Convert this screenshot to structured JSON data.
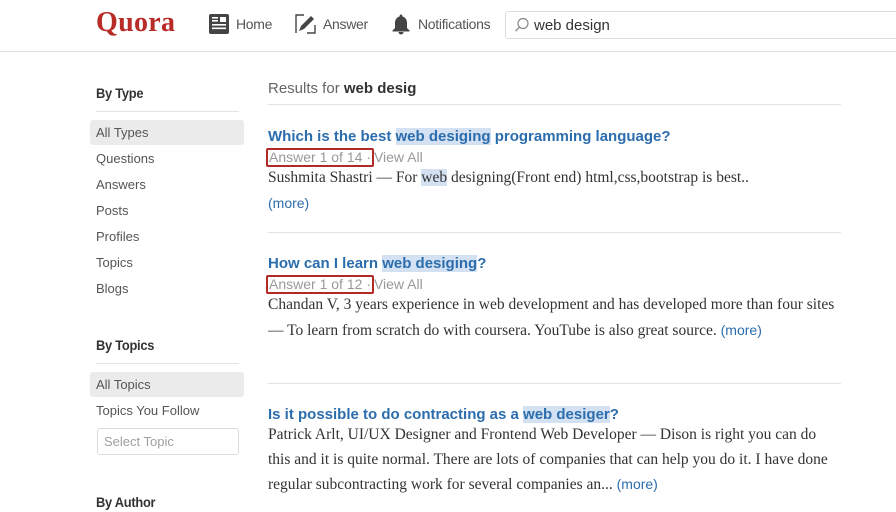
{
  "header": {
    "logo": "Quora",
    "nav": [
      {
        "label": "Home",
        "icon": "home-feed-icon"
      },
      {
        "label": "Answer",
        "icon": "pencil-answer-icon"
      },
      {
        "label": "Notifications",
        "icon": "bell-icon"
      }
    ],
    "search": {
      "value": "web design",
      "icon": "search-icon"
    }
  },
  "sidebar": {
    "by_type": {
      "heading": "By Type",
      "items": [
        {
          "label": "All Types",
          "active": true
        },
        {
          "label": "Questions"
        },
        {
          "label": "Answers"
        },
        {
          "label": "Posts"
        },
        {
          "label": "Profiles"
        },
        {
          "label": "Topics"
        },
        {
          "label": "Blogs"
        }
      ]
    },
    "by_topics": {
      "heading": "By Topics",
      "items": [
        {
          "label": "All Topics",
          "active": true
        },
        {
          "label": "Topics You Follow"
        }
      ],
      "select_placeholder": "Select Topic"
    },
    "by_author": {
      "heading": "By Author"
    }
  },
  "main": {
    "results_prefix": "Results for",
    "results_query": "web desig",
    "results": [
      {
        "title_pre": "Which is the best ",
        "title_hl": "web desiging",
        "title_post": " programming language?",
        "meta_count": "Answer 1 of 14 ·",
        "meta_link": "View All",
        "snippet_pre": "Sushmita Shastri — For ",
        "snippet_hl": "web",
        "snippet_post": " designing(Front end) html,css,bootstrap is best.. ",
        "more": "(more)"
      },
      {
        "title_pre": "How can I learn ",
        "title_hl": "web desiging",
        "title_post": "?",
        "meta_count": "Answer 1 of 12 ·",
        "meta_link": "View All",
        "snippet_pre": "Chandan V, 3 years experience in web development and has developed more than four sites — To learn from scratch do with coursera. YouTube is also great source. ",
        "snippet_hl": "",
        "snippet_post": "",
        "more": "(more)"
      },
      {
        "title_pre": "Is it possible to do contracting as a ",
        "title_hl": "web desiger",
        "title_post": "?",
        "snippet_pre": "Patrick Arlt, UI/UX Designer and Frontend Web Developer — Dison is right you can do this and it is quite normal. There are lots of companies that can help you do it. I have done regular subcontracting work for several companies an... ",
        "snippet_hl": "",
        "snippet_post": "",
        "more": "(more)"
      }
    ]
  },
  "colors": {
    "brand": "#b92b27",
    "link": "#2b6dad",
    "highlight": "#d3e1f3",
    "annotation_box": "#b12a26"
  }
}
